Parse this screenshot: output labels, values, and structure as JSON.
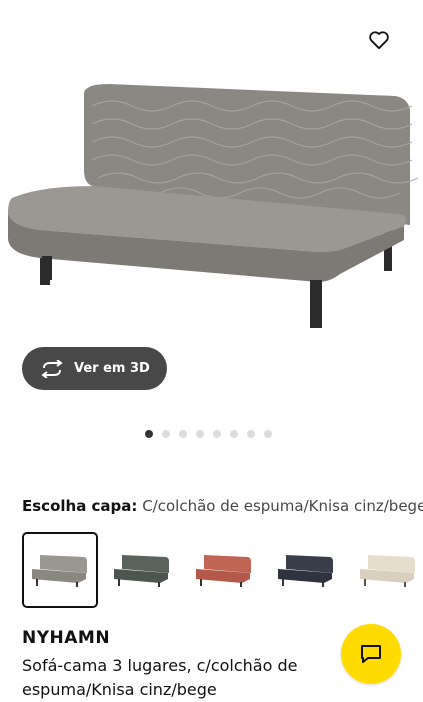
{
  "gallery": {
    "view_3d_label": "Ver em 3D",
    "image_count": 8,
    "active_index": 0
  },
  "cover": {
    "label": "Escolha capa:",
    "value": "C/colchão de espuma/Knisa cinz/bege",
    "swatches": [
      {
        "name": "Knisa cinz/bege",
        "color": "#9a9690",
        "selected": true
      },
      {
        "name": "dark green",
        "color": "#4d5550",
        "selected": false
      },
      {
        "name": "red",
        "color": "#b4584a",
        "selected": false
      },
      {
        "name": "dark blue",
        "color": "#2f3340",
        "selected": false
      },
      {
        "name": "beige",
        "color": "#dfd6c6",
        "selected": false
      }
    ]
  },
  "product": {
    "name": "NYHAMN",
    "description": "Sofá-cama 3 lugares, c/colchão de espuma/Knisa cinz/bege"
  },
  "icons": {
    "wishlist": "heart-outline-icon",
    "rotate": "rotate-3d-icon",
    "chat": "chat-bubble-icon"
  },
  "colors": {
    "accent_yellow": "#ffdb00",
    "button_dark": "#484848",
    "sofa_main": "#8f8b86"
  }
}
